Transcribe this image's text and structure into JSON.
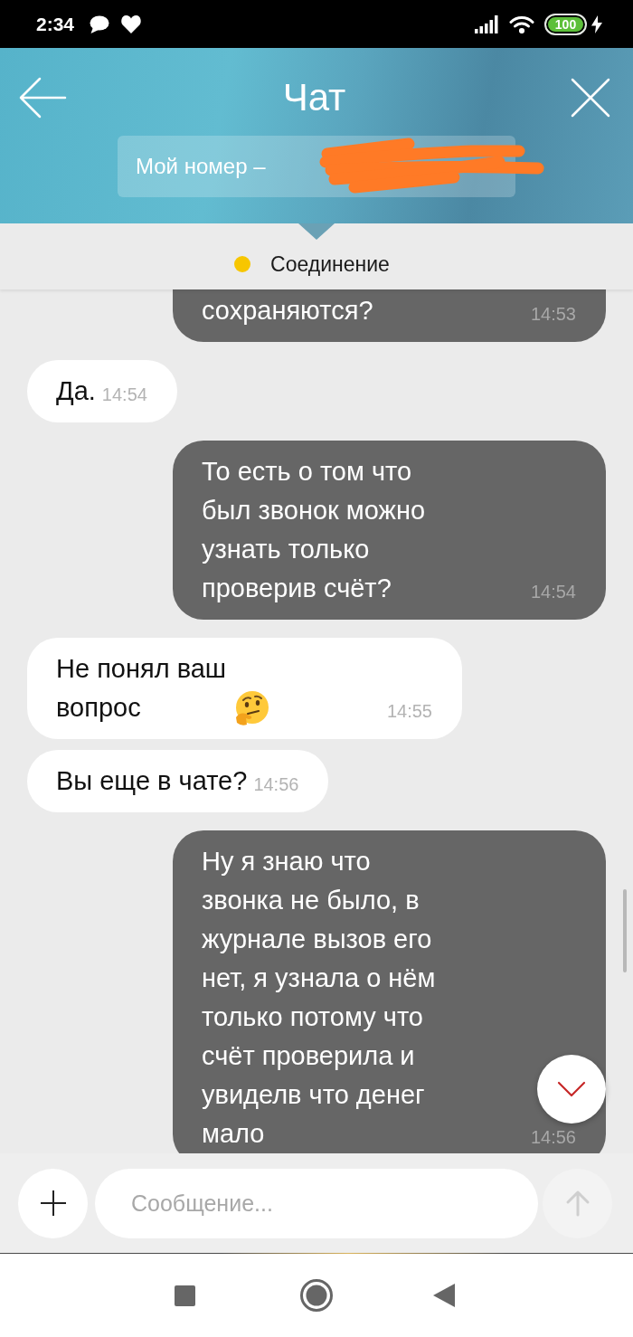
{
  "status_bar": {
    "time": "2:34",
    "battery": "100"
  },
  "header": {
    "title": "Чат",
    "phone": {
      "label": "Мой номер –",
      "redacted": true
    }
  },
  "connection": {
    "label": "Соединение",
    "connected": false
  },
  "messages": [
    {
      "kind": "outgoing",
      "text": "сохраняются?",
      "emoji": false,
      "time": "14:53"
    },
    {
      "kind": "incoming",
      "text": "Да.",
      "emoji": false,
      "time": "14:54"
    },
    {
      "kind": "outgoing",
      "text": "То есть о том что\nбыл звонок можно\nузнать только\nпроверив счёт?",
      "emoji": false,
      "time": "14:54"
    },
    {
      "kind": "incoming",
      "text": "Не понял ваш\nвопрос",
      "emoji": true,
      "time": "14:55"
    },
    {
      "kind": "incoming",
      "text": "Вы еще в чате?",
      "emoji": false,
      "time": "14:56"
    },
    {
      "kind": "outgoing",
      "text": "Ну я знаю что\nзвонка не было, в\nжурнале вызов его\nнет, я узнала о нём\nтолько потому что\nсчёт проверила и\nувиделв что денег\nмало",
      "emoji": false,
      "time": "14:56"
    }
  ],
  "composer": {
    "placeholder": "Сообщение...",
    "send_disabled": true
  }
}
